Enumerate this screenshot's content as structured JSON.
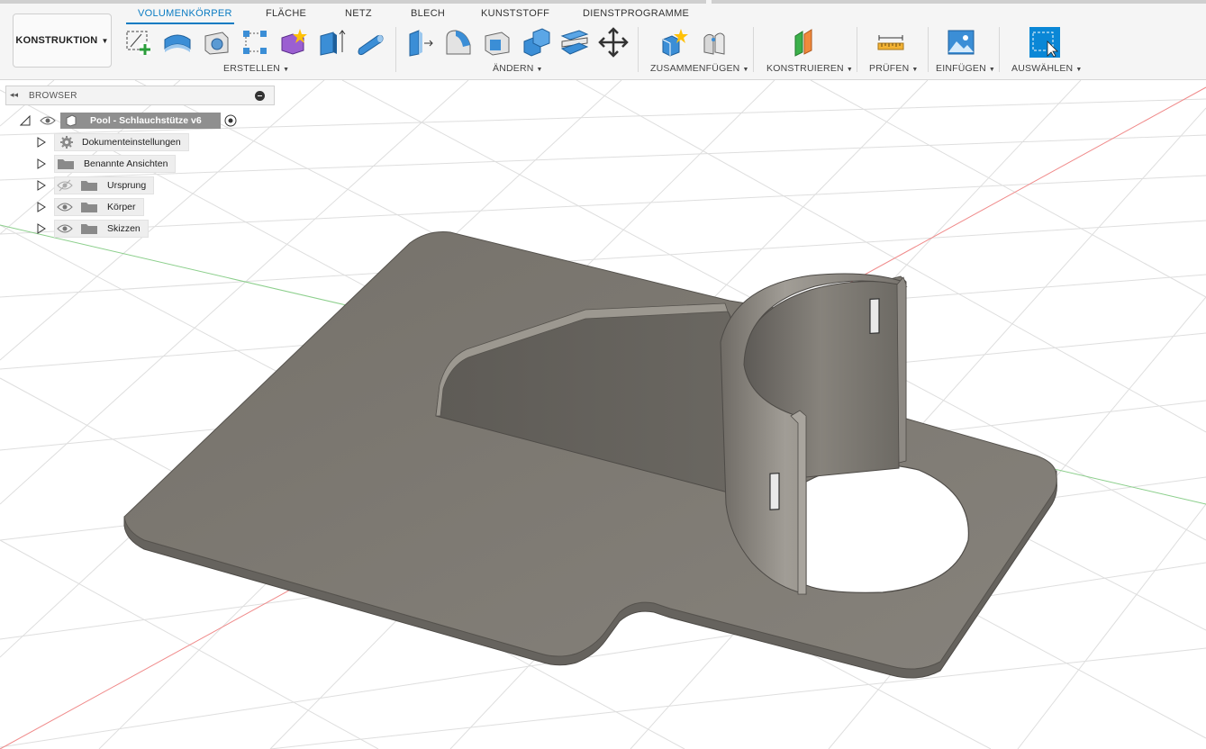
{
  "workspace": {
    "label": "KONSTRUKTION"
  },
  "tabs": [
    {
      "label": "VOLUMENKÖRPER",
      "active": true
    },
    {
      "label": "FLÄCHE"
    },
    {
      "label": "NETZ"
    },
    {
      "label": "BLECH"
    },
    {
      "label": "KUNSTSTOFF"
    },
    {
      "label": "DIENSTPROGRAMME"
    }
  ],
  "groups": [
    {
      "label": "ERSTELLEN"
    },
    {
      "label": "ÄNDERN"
    },
    {
      "label": "ZUSAMMENFÜGEN"
    },
    {
      "label": "KONSTRUIEREN"
    },
    {
      "label": "PRÜFEN"
    },
    {
      "label": "EINFÜGEN"
    },
    {
      "label": "AUSWÄHLEN"
    }
  ],
  "browser": {
    "title": "BROWSER",
    "root": {
      "label": "Pool - Schlauchstütze v6"
    },
    "items": [
      {
        "label": "Dokumenteinstellungen",
        "icon": "gear-icon"
      },
      {
        "label": "Benannte Ansichten",
        "icon": "folder-icon"
      },
      {
        "label": "Ursprung",
        "icon": "folder-icon",
        "visibility": "hidden"
      },
      {
        "label": "Körper",
        "icon": "folder-icon",
        "visibility": "visible"
      },
      {
        "label": "Skizzen",
        "icon": "folder-icon",
        "visibility": "visible"
      }
    ]
  },
  "colors": {
    "accent": "#0a7bc2",
    "model": "#7b7770",
    "grid": "#dcdcdc",
    "axis_red": "#f08a8a",
    "axis_green": "#8ccf8c"
  }
}
